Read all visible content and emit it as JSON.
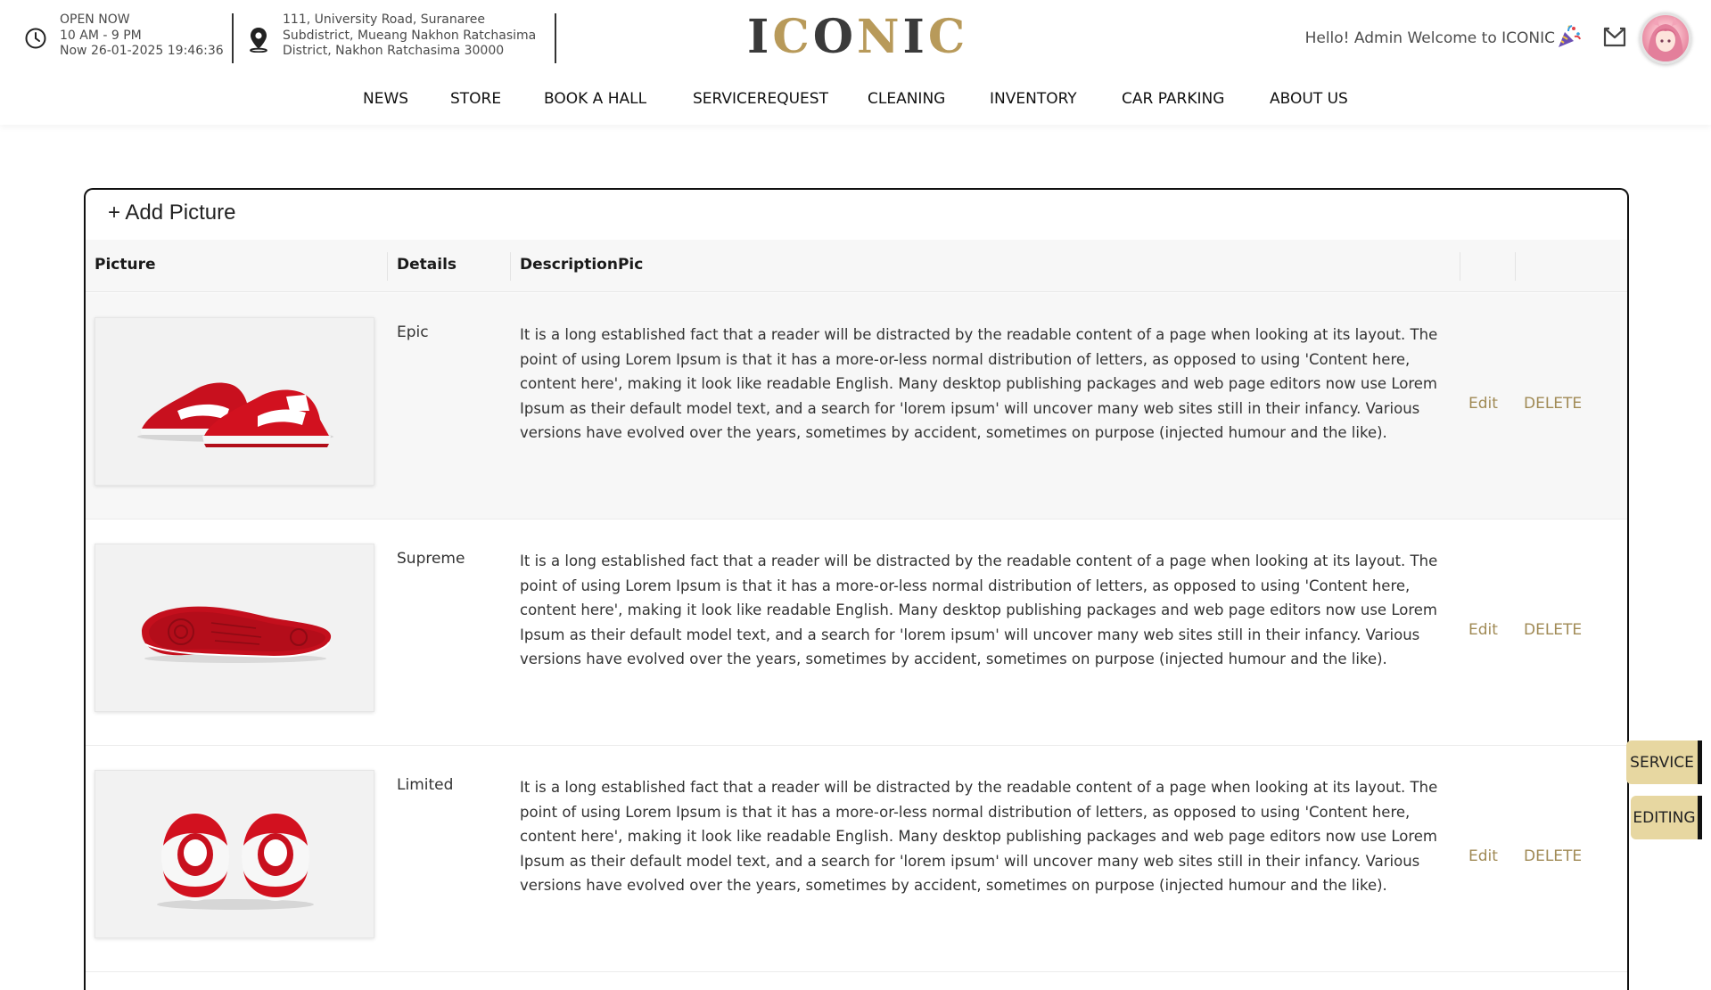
{
  "header": {
    "hours": {
      "status": "OPEN NOW",
      "time": "10 AM - 9 PM",
      "now": "Now 26-01-2025 19:46:36"
    },
    "address": {
      "line1": "111, University Road, Suranaree",
      "line2": "Subdistrict, Mueang Nakhon Ratchasima",
      "line3": "District, Nakhon Ratchasima 30000"
    },
    "logo": "ICONIC",
    "greeting": "Hello! Admin Welcome to ICONIC"
  },
  "nav": {
    "items": [
      "NEWS",
      "STORE",
      "BOOK A HALL",
      "SERVICEREQUEST",
      "CLEANING",
      "INVENTORY",
      "CAR PARKING",
      "ABOUT US"
    ]
  },
  "panel": {
    "add_label": "+ Add Picture",
    "columns": [
      "Picture",
      "Details",
      "DescriptionPic"
    ],
    "rows": [
      {
        "details": "Epic",
        "description": "It is a long established fact that a reader will be distracted by the readable content of a page when looking at its layout. The point of using Lorem Ipsum is that it has a more-or-less normal distribution of letters, as opposed to using 'Content here, content here', making it look like readable English. Many desktop publishing packages and web page editors now use Lorem Ipsum as their default model text, and a search for 'lorem ipsum' will uncover many web sites still in their infancy. Various versions have evolved over the years, sometimes by accident, sometimes on purpose (injected humour and the like).",
        "edit": "Edit",
        "delete": "DELETE"
      },
      {
        "details": "Supreme",
        "description": "It is a long established fact that a reader will be distracted by the readable content of a page when looking at its layout. The point of using Lorem Ipsum is that it has a more-or-less normal distribution of letters, as opposed to using 'Content here, content here', making it look like readable English. Many desktop publishing packages and web page editors now use Lorem Ipsum as their default model text, and a search for 'lorem ipsum' will uncover many web sites still in their infancy. Various versions have evolved over the years, sometimes by accident, sometimes on purpose (injected humour and the like).",
        "edit": "Edit",
        "delete": "DELETE"
      },
      {
        "details": "Limited",
        "description": "It is a long established fact that a reader will be distracted by the readable content of a page when looking at its layout. The point of using Lorem Ipsum is that it has a more-or-less normal distribution of letters, as opposed to using 'Content here, content here', making it look like readable English. Many desktop publishing packages and web page editors now use Lorem Ipsum as their default model text, and a search for 'lorem ipsum' will uncover many web sites still in their infancy. Various versions have evolved over the years, sometimes by accident, sometimes on purpose (injected humour and the like).",
        "edit": "Edit",
        "delete": "DELETE"
      }
    ]
  },
  "side_tabs": {
    "service": "SERVICE",
    "editing": "EDITING"
  },
  "icons": {
    "clock": "clock-icon",
    "location": "location-pin-icon",
    "party": "party-popper-icon",
    "mail": "mail-icon"
  },
  "colors": {
    "action_text": "#a08a55",
    "side_tab_bg": "#e7d7a1",
    "shoe_red": "#d2111f",
    "logo_gold": "#b89a5a"
  }
}
